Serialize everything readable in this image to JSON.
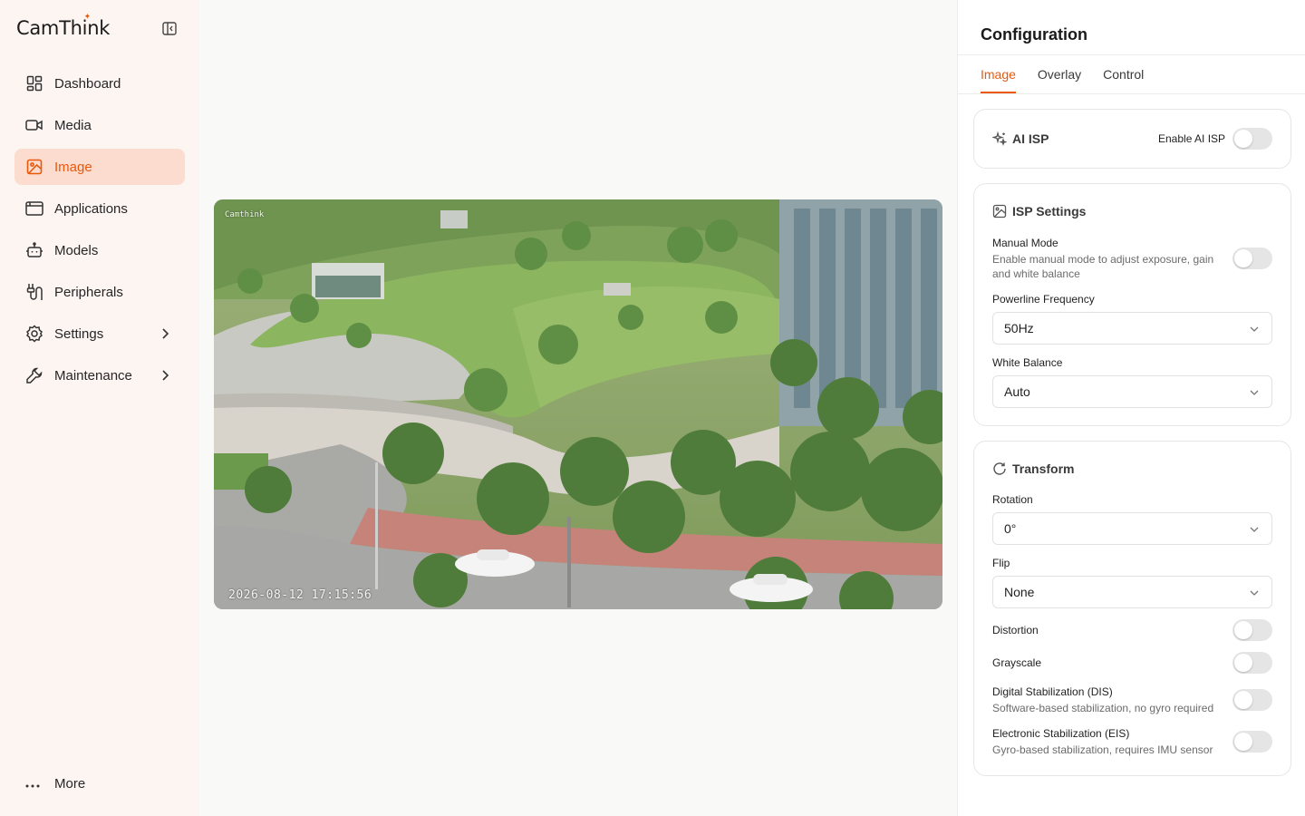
{
  "app": {
    "brand_prefix": "CamTh",
    "brand_suffix": "nk",
    "brand_i": "i"
  },
  "sidebar": {
    "items": [
      {
        "label": "Dashboard",
        "icon": "dashboard-icon",
        "active": false
      },
      {
        "label": "Media",
        "icon": "video-icon",
        "active": false
      },
      {
        "label": "Image",
        "icon": "image-icon",
        "active": true
      },
      {
        "label": "Applications",
        "icon": "applications-icon",
        "active": false
      },
      {
        "label": "Models",
        "icon": "robot-icon",
        "active": false
      },
      {
        "label": "Peripherals",
        "icon": "peripherals-icon",
        "active": false
      },
      {
        "label": "Settings",
        "icon": "gear-icon",
        "active": false
      },
      {
        "label": "Maintenance",
        "icon": "wrench-icon",
        "active": false
      }
    ],
    "more_label": "More"
  },
  "preview": {
    "osd_label": "Camthink",
    "timestamp": "2026-08-12 17:15:56"
  },
  "panel": {
    "title": "Configuration",
    "tabs": [
      "Image",
      "Overlay",
      "Control"
    ],
    "active_tab": "Image",
    "ai_isp": {
      "title": "AI ISP",
      "toggle_label": "Enable AI ISP",
      "enabled": false
    },
    "isp": {
      "title": "ISP Settings",
      "manual_mode_label": "Manual Mode",
      "manual_mode_desc": "Enable manual mode to adjust exposure, gain and white balance",
      "manual_mode_enabled": false,
      "powerline_label": "Powerline Frequency",
      "powerline_value": "50Hz",
      "wb_label": "White Balance",
      "wb_value": "Auto"
    },
    "transform": {
      "title": "Transform",
      "rotation_label": "Rotation",
      "rotation_value": "0°",
      "flip_label": "Flip",
      "flip_value": "None",
      "distortion_label": "Distortion",
      "grayscale_label": "Grayscale",
      "dis_label": "Digital Stabilization (DIS)",
      "dis_desc": "Software-based stabilization, no gyro required",
      "eis_label": "Electronic Stabilization (EIS)",
      "eis_desc": "Gyro-based stabilization, requires IMU sensor"
    }
  },
  "colors": {
    "accent": "#e8590c",
    "sidebar_bg": "#fdf5f2",
    "active_bg": "#fbdccf"
  }
}
